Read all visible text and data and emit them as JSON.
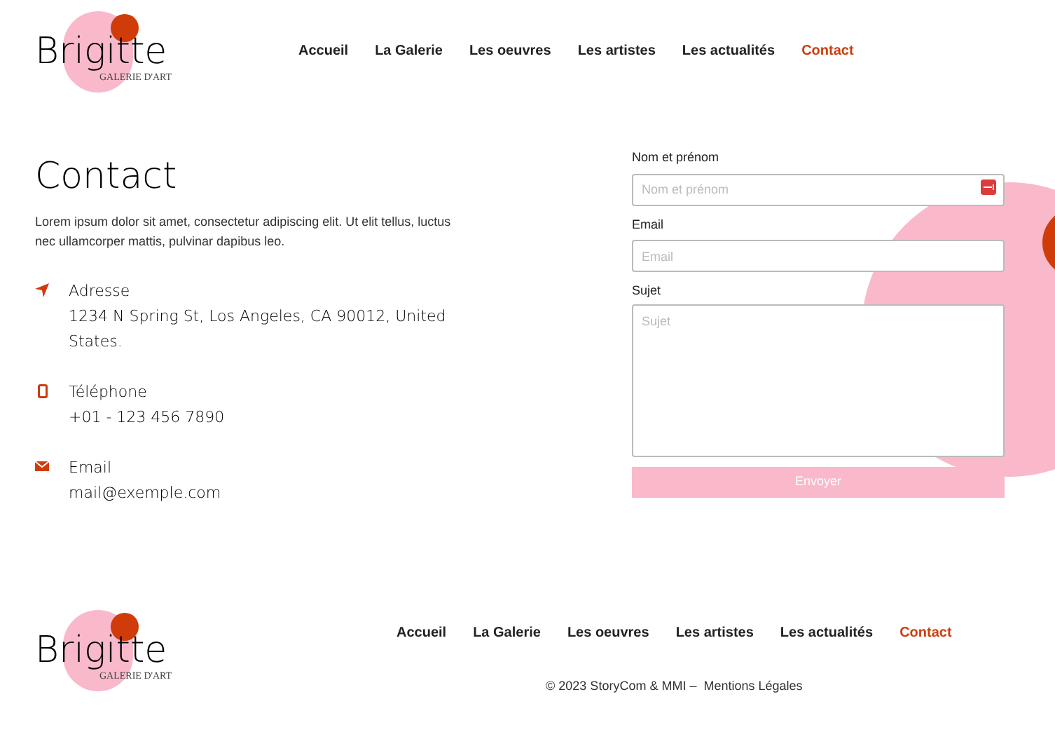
{
  "header": {
    "logo": {
      "name": "Brigitte",
      "tagline": "GALERIE D'ART"
    },
    "nav": [
      {
        "label": "Accueil",
        "selected": false
      },
      {
        "label": "La Galerie",
        "selected": false
      },
      {
        "label": "Les oeuvres",
        "selected": false
      },
      {
        "label": "Les artistes",
        "selected": false
      },
      {
        "label": "Les actualités",
        "selected": false
      },
      {
        "label": "Contact",
        "selected": true
      }
    ]
  },
  "contact": {
    "title": "Contact",
    "intro": "Lorem ipsum dolor sit amet, consectetur adipiscing elit. Ut elit tellus, luctus nec ullamcorper mattis, pulvinar dapibus leo.",
    "items": [
      {
        "kind": "address",
        "label": "Adresse",
        "value": "1234 N Spring St, Los Angeles, CA 90012, United States."
      },
      {
        "kind": "phone",
        "label": "Téléphone",
        "value": "+01 - 123 456 7890"
      },
      {
        "kind": "email",
        "label": "Email",
        "value": "mail@exemple.com"
      }
    ]
  },
  "form": {
    "fields": [
      {
        "kind": "text",
        "label": "Nom et prénom",
        "placeholder": "Nom et prénom"
      },
      {
        "kind": "text",
        "label": "Email",
        "placeholder": "Email"
      },
      {
        "kind": "textarea",
        "label": "Sujet",
        "placeholder": "Sujet"
      }
    ],
    "submit": "Envoyer"
  },
  "footer": {
    "logo": {
      "name": "Brigitte",
      "tagline": "GALERIE D'ART"
    },
    "nav": [
      {
        "label": "Accueil",
        "selected": false
      },
      {
        "label": "La Galerie",
        "selected": false
      },
      {
        "label": "Les oeuvres",
        "selected": false
      },
      {
        "label": "Les artistes",
        "selected": false
      },
      {
        "label": "Les actualités",
        "selected": false
      },
      {
        "label": "Contact",
        "selected": true
      }
    ],
    "copyright": "© 2023 StoryCom & MMI –  Mentions Légales"
  }
}
